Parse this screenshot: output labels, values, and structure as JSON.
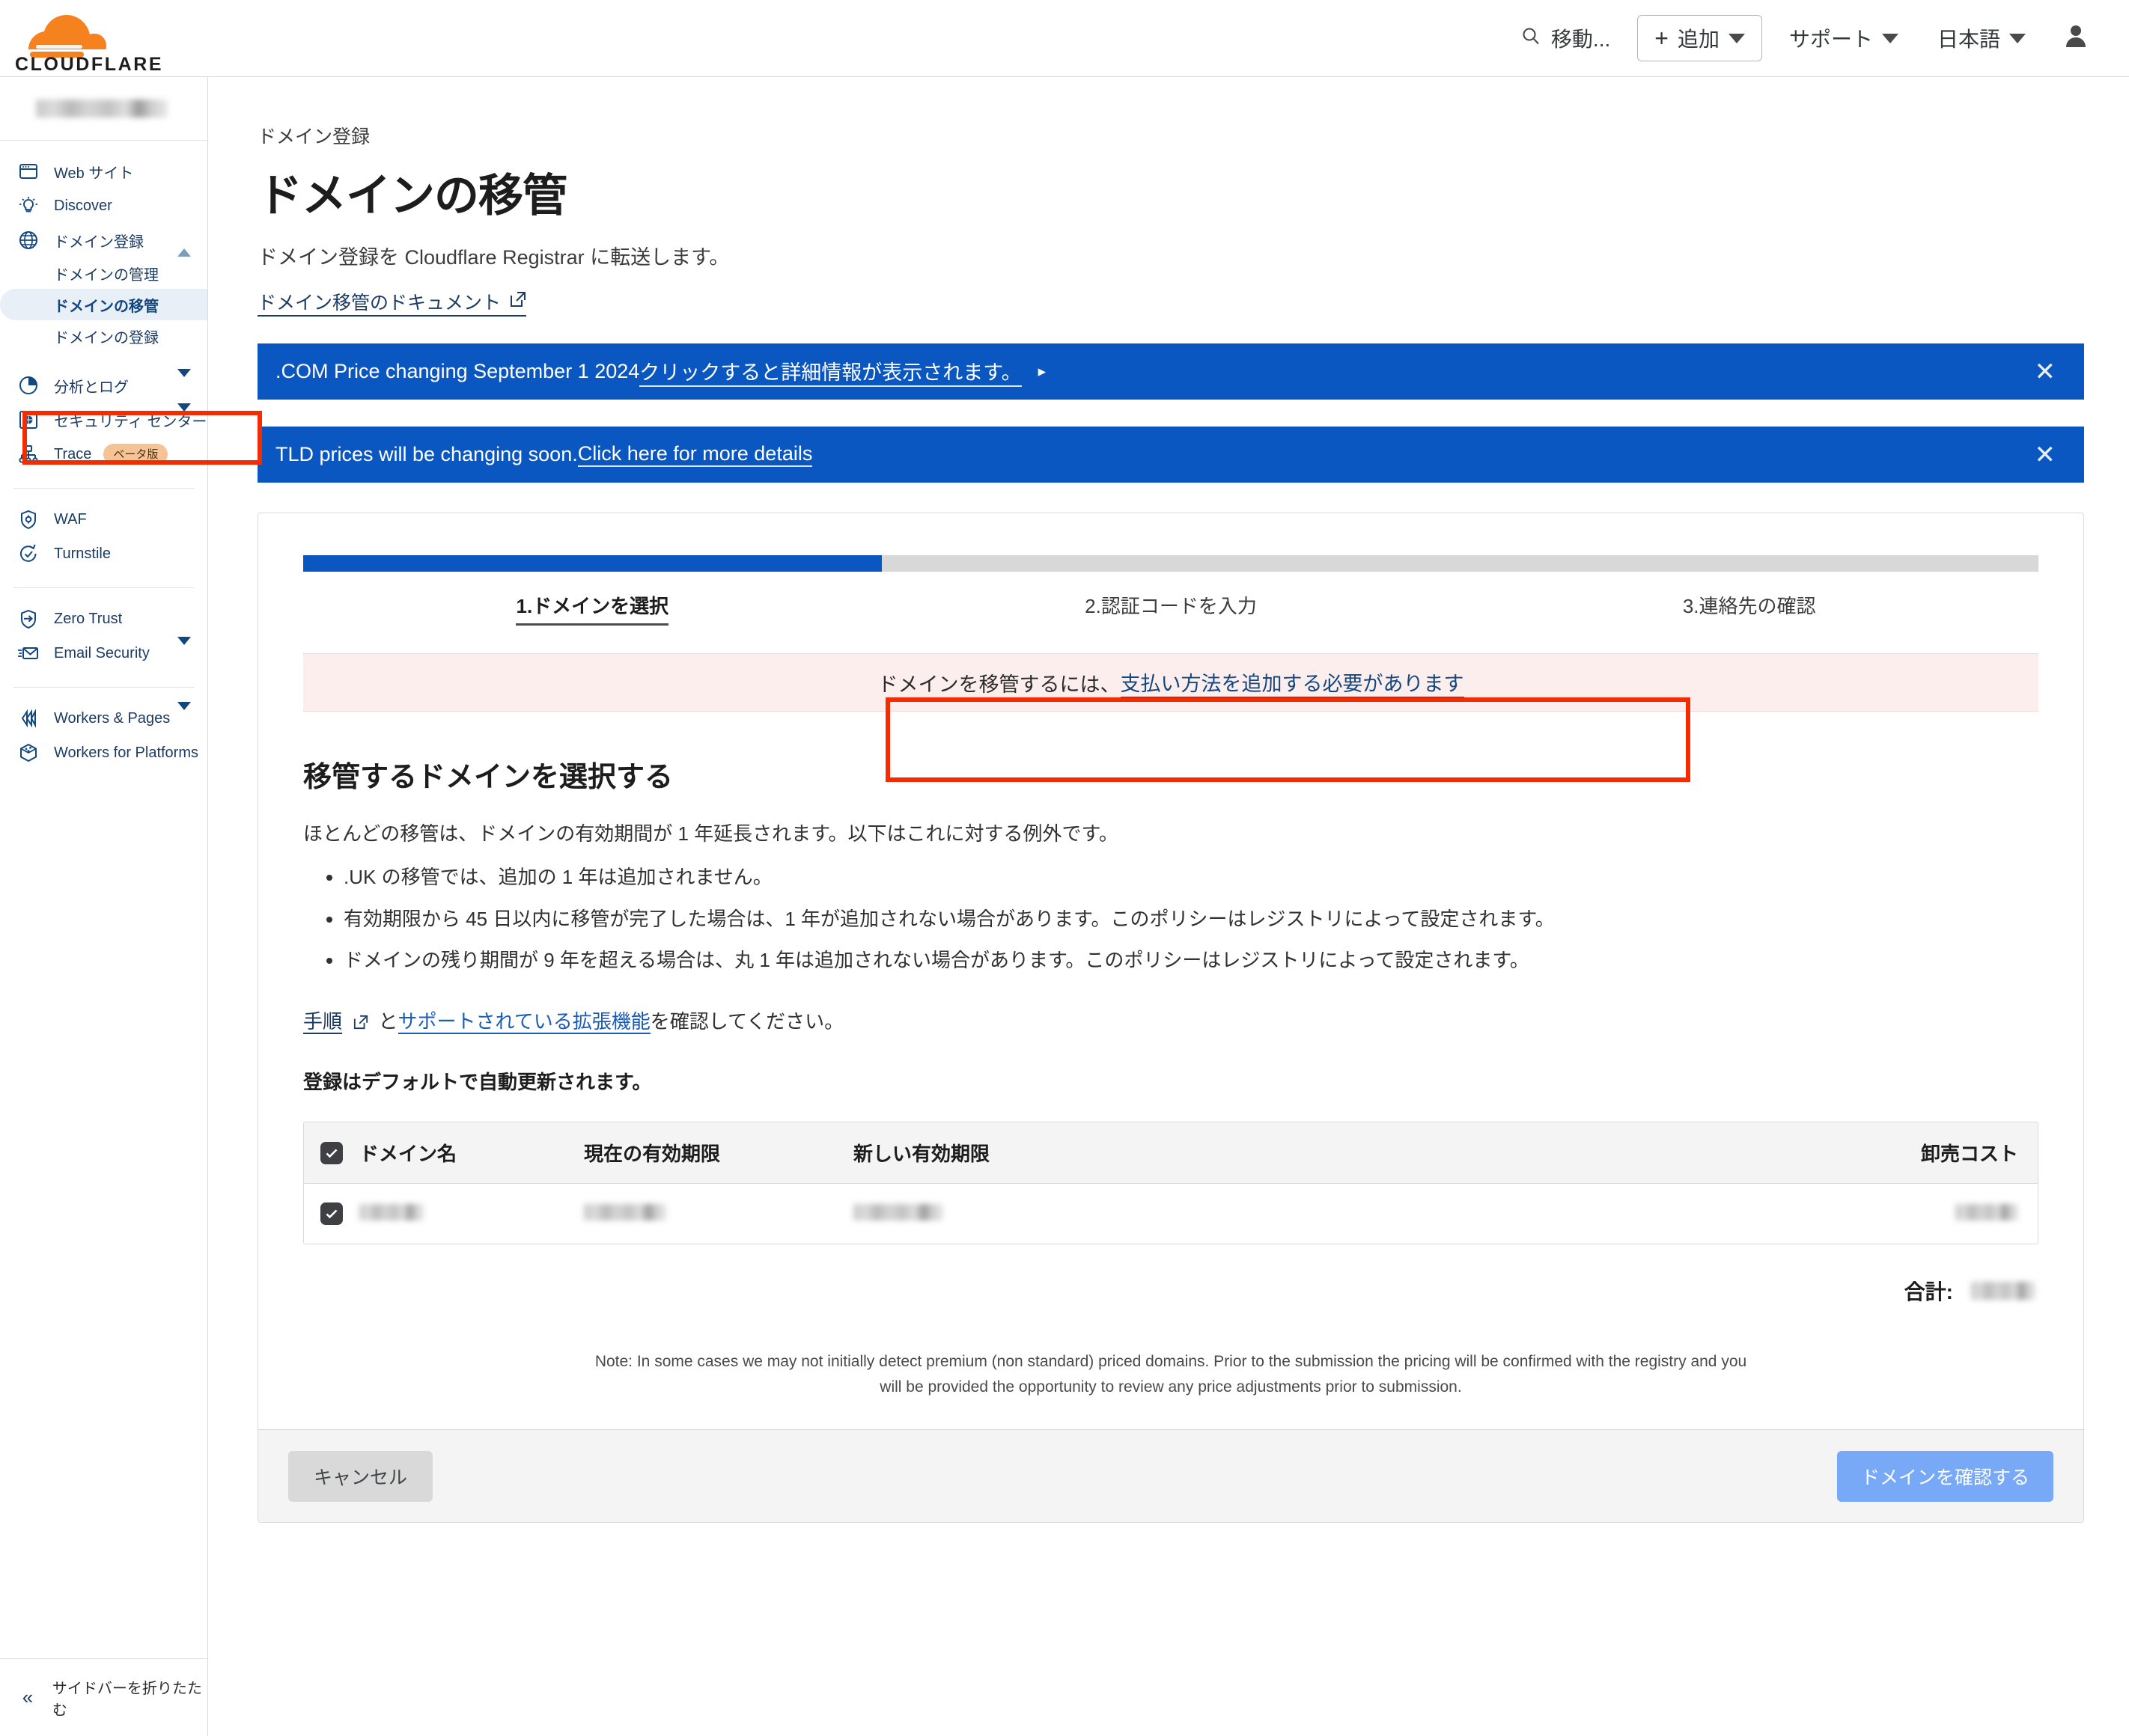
{
  "brand": {
    "name": "CLOUDFLARE",
    "logo_orange": "#f6821f",
    "logo_orange_light": "#fbad41"
  },
  "topnav": {
    "search_label": "移動...",
    "add_label": "追加",
    "support_label": "サポート",
    "language_label": "日本語",
    "account_icon": "user-icon",
    "search_icon": "search-icon",
    "plus_icon": "plus-icon"
  },
  "sidebar": {
    "account_name_redacted": "",
    "items": [
      {
        "label": "Web サイト",
        "icon": "browser-window-icon",
        "expandable": false
      },
      {
        "label": "Discover",
        "icon": "lightbulb-icon",
        "expandable": false
      },
      {
        "label": "ドメイン登録",
        "icon": "globe-icon",
        "expandable": true,
        "expanded": true
      }
    ],
    "registrar_subitems": [
      {
        "label": "ドメインの管理",
        "active": false
      },
      {
        "label": "ドメインの移管",
        "active": true
      },
      {
        "label": "ドメインの登録",
        "active": false
      }
    ],
    "items2": [
      {
        "label": "分析とログ",
        "icon": "pie-chart-icon",
        "expandable": true
      },
      {
        "label": "セキュリティ センター",
        "icon": "shield-box-icon",
        "expandable": true
      },
      {
        "label": "Trace",
        "icon": "trace-nodes-icon",
        "expandable": false,
        "badge": "ベータ版"
      }
    ],
    "items3": [
      {
        "label": "WAF",
        "icon": "shield-gear-icon",
        "expandable": false
      },
      {
        "label": "Turnstile",
        "icon": "clock-check-icon",
        "expandable": true
      }
    ],
    "items4": [
      {
        "label": "Zero Trust",
        "icon": "shield-arrow-icon",
        "expandable": false
      },
      {
        "label": "Email Security",
        "icon": "envelope-icon",
        "expandable": true
      }
    ],
    "items5": [
      {
        "label": "Workers & Pages",
        "icon": "workers-icon",
        "expandable": true
      },
      {
        "label": "Workers for Platforms",
        "icon": "cube-icon",
        "expandable": false
      }
    ],
    "collapse_label": "サイドバーを折りたたむ",
    "collapse_icon": "chevrons-left-icon"
  },
  "page": {
    "breadcrumb": "ドメイン登録",
    "title": "ドメインの移管",
    "subtitle": "ドメイン登録を Cloudflare Registrar に転送します。",
    "doc_link": "ドメイン移管のドキュメント",
    "doc_link_icon": "external-link-icon"
  },
  "banners": [
    {
      "static_text": ".COM Price changing September 1 2024 ",
      "link_text": "クリックすると詳細情報が表示されます。",
      "arrow": "▸",
      "close_icon": "close-icon",
      "bg": "#0a57c2"
    },
    {
      "static_text": "TLD prices will be changing soon. ",
      "link_text": "Click here for more details",
      "arrow": "",
      "close_icon": "close-icon",
      "bg": "#0a57c2"
    }
  ],
  "stepper": {
    "steps": [
      {
        "label": "1.ドメインを選択",
        "done": true
      },
      {
        "label": "2.認証コードを入力",
        "done": false
      },
      {
        "label": "3.連絡先の確認",
        "done": false
      }
    ],
    "active_color": "#0a57c2",
    "inactive_color": "#d8d8d8"
  },
  "alert": {
    "prefix": "ドメインを移管するには、",
    "link": "支払い方法を追加する必要があります",
    "bg": "#fdeeee",
    "link_color": "#13477f"
  },
  "section": {
    "heading": "移管するドメインを選択する",
    "intro": "ほとんどの移管は、ドメインの有効期間が 1 年延長されます。以下はこれに対する例外です。",
    "exceptions": [
      ".UK の移管では、追加の 1 年は追加されません。",
      "有効期限から 45 日以内に移管が完了した場合は、1 年が追加されない場合があります。このポリシーはレジストリによって設定されます。",
      "ドメインの残り期間が 9 年を超える場合は、丸 1 年は追加されない場合があります。このポリシーはレジストリによって設定されます。"
    ],
    "links_line": {
      "link1": "手順",
      "link1_icon": "external-link-icon",
      "conj": "と",
      "link2": "サポートされている拡張機能",
      "suffix": "を確認してください。"
    },
    "autorenew_note": "登録はデフォルトで自動更新されます。"
  },
  "table": {
    "header_checkbox_checked": true,
    "columns": [
      "ドメイン名",
      "現在の有効期限",
      "新しい有効期限",
      "卸売コスト"
    ],
    "rows": [
      {
        "checked": true,
        "domain": "",
        "current_expiry": "",
        "new_expiry": "",
        "wholesale_cost": ""
      }
    ],
    "total_label": "合計:",
    "total_value": ""
  },
  "note": "Note: In some cases we may not initially detect premium (non standard) priced domains. Prior to the submission the pricing will be confirmed with the registry and you will be provided the opportunity to review any price adjustments prior to submission.",
  "footer": {
    "cancel_label": "キャンセル",
    "confirm_label": "ドメインを確認する",
    "confirm_bg": "#78a9f7"
  },
  "annotations": {
    "highlight_color": "#f42c04",
    "boxes": [
      "sidebar-item-domain-transfer",
      "payment-method-alert"
    ]
  }
}
